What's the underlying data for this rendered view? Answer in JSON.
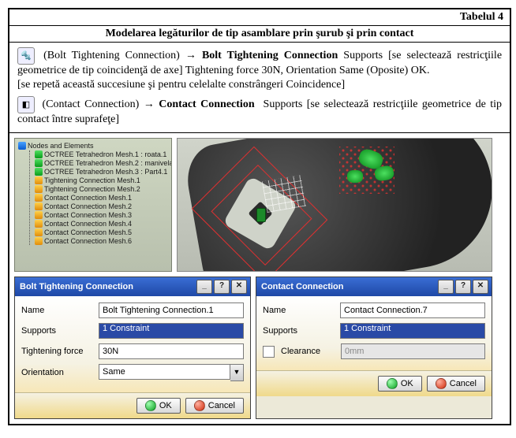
{
  "table_label": "Tabelul 4",
  "title": "Modelarea legăturilor de tip asamblare prin şurub şi prin contact",
  "para1_lead": "(Bolt Tightening Connection) →",
  "para1_bold": "Bolt Tightening Connection",
  "para1_rest": "Supports [se selectează restricţiile geometrice de tip coincidenţă de axe] Tightening force 30N, Orientation Same (Oposite) OK.",
  "para1_note": "[se repetă această succesiune şi pentru celelalte constrângeri Coincidence]",
  "para2_lead": "(Contact Connection) →",
  "para2_bold": "Contact Connection",
  "para2_rest": "Supports [se selectează restricţiile geometrice de tip contact între suprafeţe]",
  "tree": {
    "root": "Nodes and Elements",
    "items": [
      "OCTREE Tetrahedron Mesh.1 : roata.1",
      "OCTREE Tetrahedron Mesh.2 : manivela.1",
      "OCTREE Tetrahedron Mesh.3 : Part4.1",
      "Tightening Connection Mesh.1",
      "Tightening Connection Mesh.2",
      "Contact Connection Mesh.1",
      "Contact Connection Mesh.2",
      "Contact Connection Mesh.3",
      "Contact Connection Mesh.4",
      "Contact Connection Mesh.5",
      "Contact Connection Mesh.6"
    ]
  },
  "dlg1": {
    "title": "Bolt Tightening Connection",
    "name_label": "Name",
    "name_value": "Bolt Tightening Connection.1",
    "supports_label": "Supports",
    "supports_value": "1 Constraint",
    "force_label": "Tightening force",
    "force_value": "30N",
    "orient_label": "Orientation",
    "orient_value": "Same"
  },
  "dlg2": {
    "title": "Contact Connection",
    "name_label": "Name",
    "name_value": "Contact Connection.7",
    "supports_label": "Supports",
    "supports_value": "1 Constraint",
    "clearance_label": "Clearance",
    "clearance_value": "0mm"
  },
  "buttons": {
    "ok": "OK",
    "cancel": "Cancel"
  },
  "winbtns": {
    "help": "?",
    "close": "✕",
    "min": "_"
  }
}
